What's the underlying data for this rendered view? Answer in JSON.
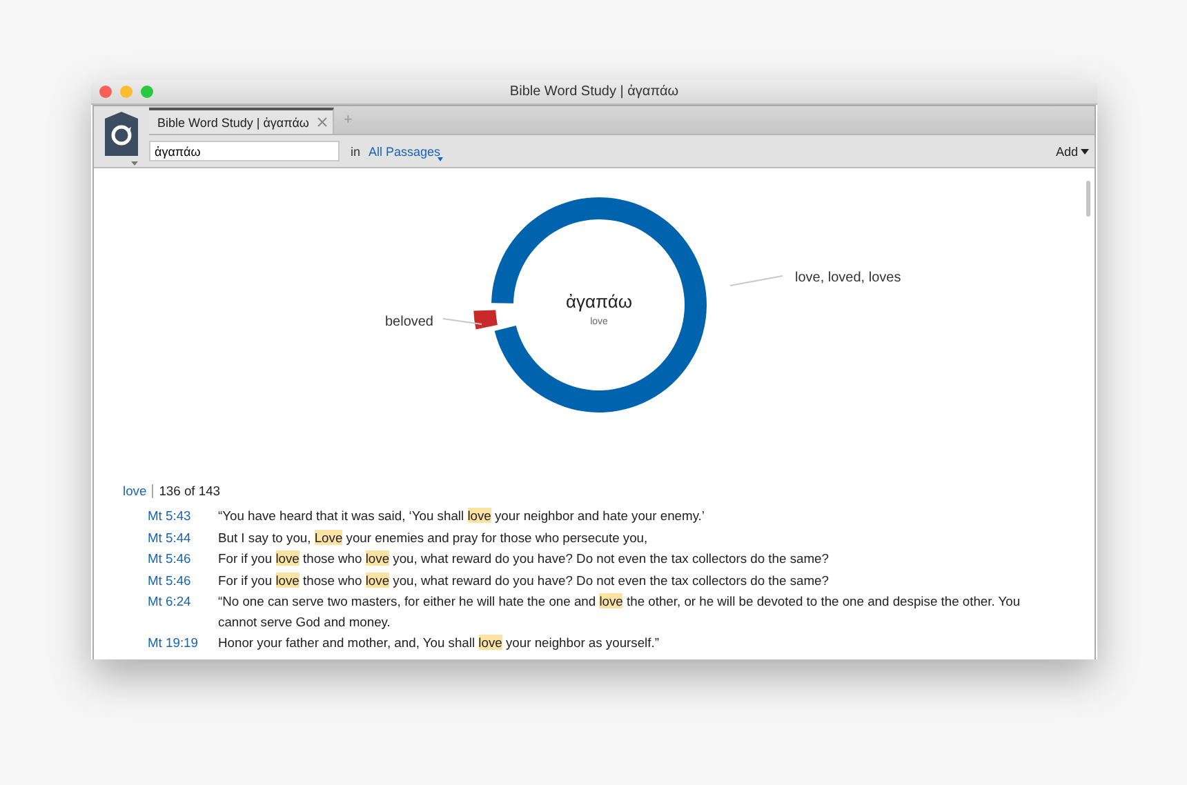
{
  "window": {
    "title": "Bible Word Study | ἀγαπάω"
  },
  "tabs": [
    {
      "label": "Bible Word Study | ἀγαπάω",
      "selected": true
    }
  ],
  "new_tab": "+",
  "toolbar": {
    "search_value": "ἀγαπάω",
    "in_label": "in",
    "range_link": "All Passages",
    "add_button": "Add"
  },
  "chart": {
    "center_word": "ἀγαπάω",
    "center_gloss": "love",
    "segments": [
      {
        "label": "love, loved, loves",
        "color": "#0063ae",
        "exploded": false
      },
      {
        "label": "beloved",
        "color": "#c8292b",
        "exploded": true
      }
    ]
  },
  "results": {
    "term": "love",
    "count": "136 of 143",
    "rows": [
      {
        "reference": "Mt 5:43",
        "segments": [
          {
            "text": "“You have heard that it was said, ‘You shall ",
            "highlight": false
          },
          {
            "text": "love",
            "highlight": true
          },
          {
            "text": " your neighbor and hate your enemy.’",
            "highlight": false
          }
        ]
      },
      {
        "reference": "Mt 5:44",
        "segments": [
          {
            "text": "But I say to you, ",
            "highlight": false
          },
          {
            "text": "Love",
            "highlight": true
          },
          {
            "text": " your enemies and pray for those who persecute you,",
            "highlight": false
          }
        ]
      },
      {
        "reference": "Mt 5:46",
        "segments": [
          {
            "text": "For if you ",
            "highlight": false
          },
          {
            "text": "love",
            "highlight": true
          },
          {
            "text": " those who ",
            "highlight": false
          },
          {
            "text": "love",
            "highlight": true
          },
          {
            "text": " you, what reward do you have? Do not even the tax collectors do the same?",
            "highlight": false
          }
        ]
      },
      {
        "reference": "Mt 5:46",
        "segments": [
          {
            "text": "For if you ",
            "highlight": false
          },
          {
            "text": "love",
            "highlight": true
          },
          {
            "text": " those who ",
            "highlight": false
          },
          {
            "text": "love",
            "highlight": true
          },
          {
            "text": " you, what reward do you have? Do not even the tax collectors do the same?",
            "highlight": false
          }
        ]
      },
      {
        "reference": "Mt 6:24",
        "segments": [
          {
            "text": "“No one can serve two masters, for either he will hate the one and ",
            "highlight": false
          },
          {
            "text": "love",
            "highlight": true
          },
          {
            "text": " the other, or he will be devoted to the one and despise the other. You cannot serve God and money.",
            "highlight": false
          }
        ]
      },
      {
        "reference": "Mt 19:19",
        "segments": [
          {
            "text": "Honor your father and mother, and, You shall ",
            "highlight": false
          },
          {
            "text": "love",
            "highlight": true
          },
          {
            "text": " your neighbor as yourself.”",
            "highlight": false
          }
        ]
      }
    ]
  }
}
